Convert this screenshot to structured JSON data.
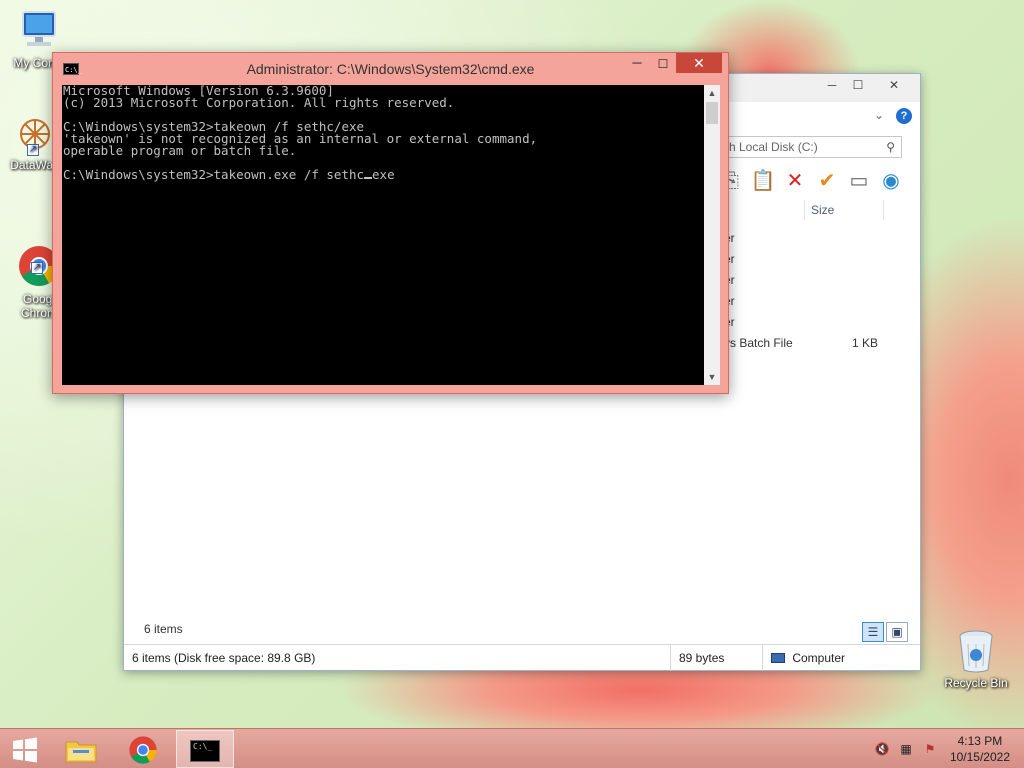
{
  "desktop": {
    "icons": [
      {
        "label": "My Comp",
        "icon": "computer-icon"
      },
      {
        "label": "DataWag",
        "icon": "datawag-icon"
      },
      {
        "label": "Googl\nChrom",
        "icon": "chrome-icon"
      }
    ],
    "recycle_bin": {
      "label": "Recycle Bin",
      "icon": "recycle-bin-icon"
    }
  },
  "explorer": {
    "search_text": "rch Local Disk (C:)",
    "column_size": "Size",
    "files": [
      {
        "type": "er",
        "size": ""
      },
      {
        "type": "er",
        "size": ""
      },
      {
        "type": "er",
        "size": ""
      },
      {
        "type": "er",
        "size": ""
      },
      {
        "type": "er",
        "size": ""
      },
      {
        "type": "vs Batch File",
        "size": "1 KB"
      }
    ],
    "items_count": "6 items",
    "status": {
      "summary": "6 items (Disk free space: 89.8 GB)",
      "size": "89 bytes",
      "location": "Computer"
    }
  },
  "cmd": {
    "title": "Administrator: C:\\Windows\\System32\\cmd.exe",
    "icon_text": "C:\\_",
    "close_label": "✕",
    "lines": [
      "Microsoft Windows [Version 6.3.9600]",
      "(c) 2013 Microsoft Corporation. All rights reserved.",
      "",
      "C:\\Windows\\system32>takeown /f sethc/exe",
      "'takeown' is not recognized as an internal or external command,",
      "operable program or batch file.",
      "",
      "C:\\Windows\\system32>takeown.exe /f sethc"
    ],
    "input_tail": "exe"
  },
  "taskbar": {
    "items": [
      {
        "name": "start-button",
        "icon": "windows-logo-icon"
      },
      {
        "name": "file-explorer",
        "icon": "folder-icon"
      },
      {
        "name": "chrome",
        "icon": "chrome-icon"
      },
      {
        "name": "cmd",
        "icon": "cmd-icon",
        "active": true
      }
    ],
    "clock_time": "4:13 PM",
    "clock_date": "10/15/2022"
  }
}
